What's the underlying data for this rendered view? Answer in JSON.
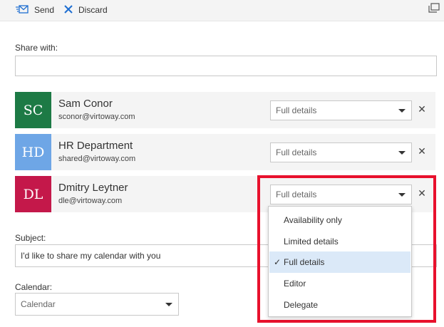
{
  "toolbar": {
    "send_label": "Send",
    "discard_label": "Discard",
    "send_icon": "send-mail-icon",
    "discard_icon": "close-x-icon",
    "popout_icon": "popout-window-icon",
    "accent_color": "#1e6ed1"
  },
  "share": {
    "label": "Share with:",
    "value": ""
  },
  "people": [
    {
      "initials": "SC",
      "name": "Sam Conor",
      "email": "sconor@virtoway.com",
      "permission": "Full details",
      "color": "#1d7a45"
    },
    {
      "initials": "HD",
      "name": "HR Department",
      "email": "shared@virtoway.com",
      "permission": "Full details",
      "color": "#6ea6e6"
    },
    {
      "initials": "DL",
      "name": "Dmitry Leytner",
      "email": "dle@virtoway.com",
      "permission": "Full details",
      "color": "#c4184a"
    }
  ],
  "permission_menu": {
    "options": [
      "Availability only",
      "Limited details",
      "Full details",
      "Editor",
      "Delegate"
    ],
    "selected": "Full details",
    "check_mark": "✓"
  },
  "subject": {
    "label": "Subject:",
    "value": "I'd like to share my calendar with you"
  },
  "calendar": {
    "label": "Calendar:",
    "value": "Calendar"
  },
  "highlight_color": "#e8112d",
  "remove_glyph": "✕"
}
